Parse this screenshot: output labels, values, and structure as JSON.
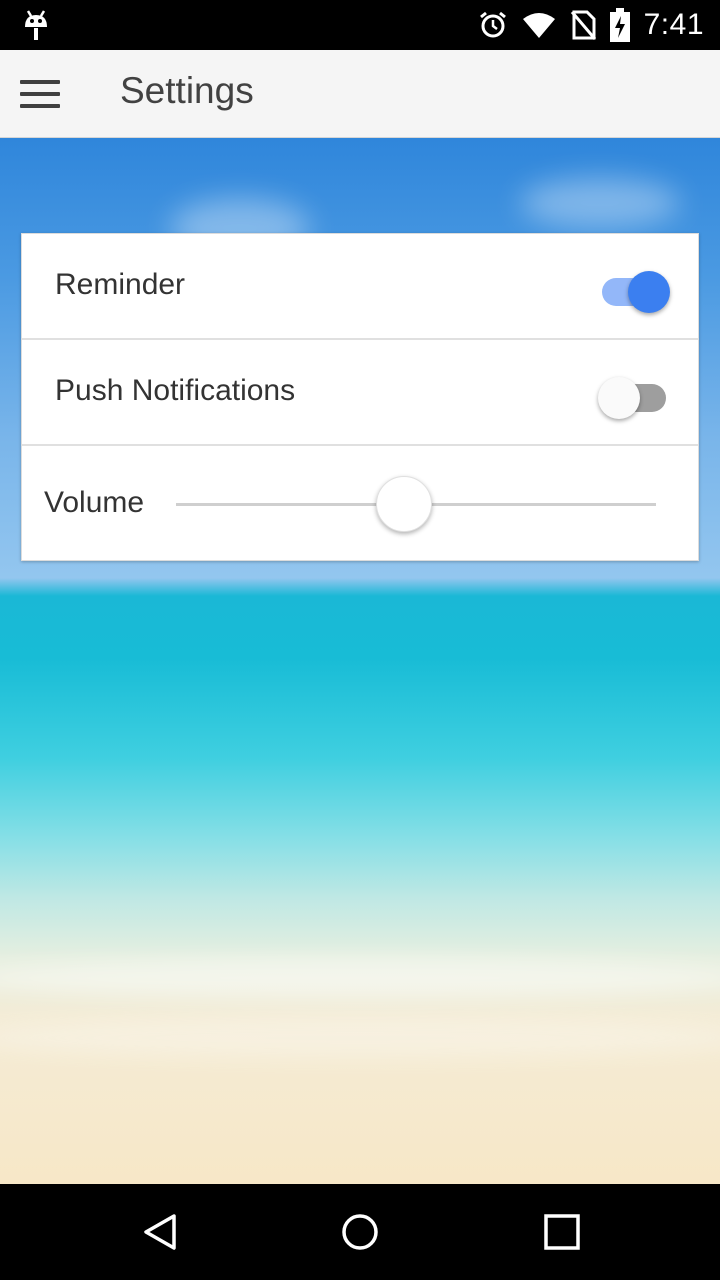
{
  "status_bar": {
    "time": "7:41",
    "icons": [
      "android-debug-icon",
      "alarm-icon",
      "wifi-icon",
      "no-sim-icon",
      "battery-charging-icon"
    ]
  },
  "app_bar": {
    "title": "Settings",
    "menu_icon": "hamburger-menu-icon"
  },
  "settings": {
    "reminder": {
      "label": "Reminder",
      "enabled": true
    },
    "push_notifications": {
      "label": "Push Notifications",
      "enabled": false
    },
    "volume": {
      "label": "Volume",
      "value_fraction": 0.475
    }
  },
  "colors": {
    "accent": "#3b7ff0",
    "accent_track": "#93b7f9"
  },
  "nav_bar": {
    "icons": [
      "back-icon",
      "home-icon",
      "recents-icon"
    ]
  }
}
